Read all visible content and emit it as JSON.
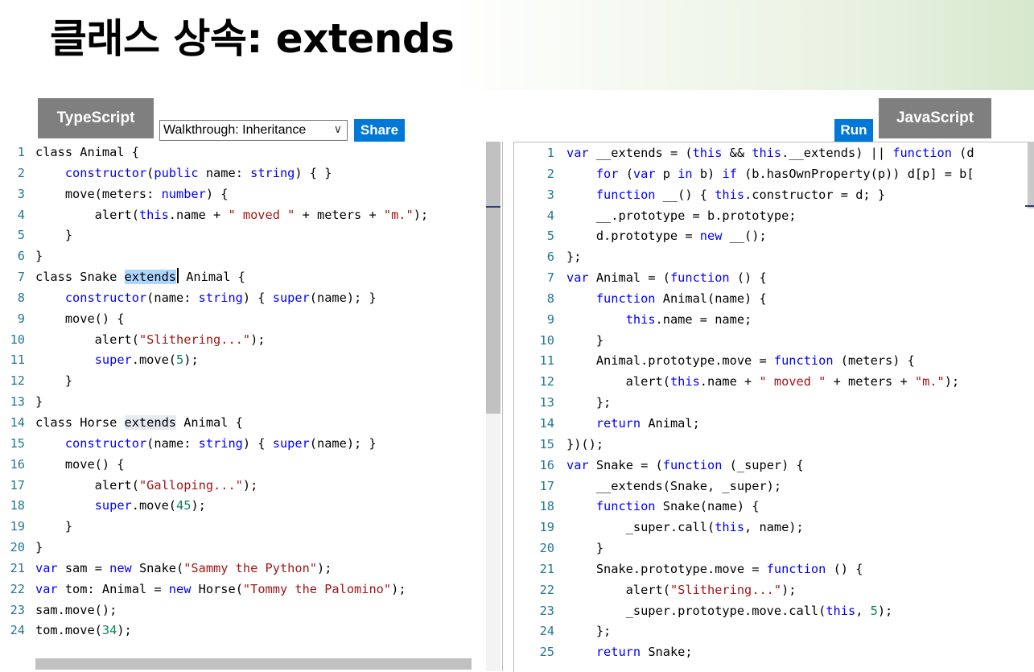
{
  "page_title": "클래스 상속: extends",
  "typescript_tab": "TypeScript",
  "javascript_tab": "JavaScript",
  "walkthrough_select": {
    "selected": "Walkthrough: Inheritance"
  },
  "share_button": "Share",
  "run_button": "Run",
  "ts_code": [
    {
      "n": "1",
      "t": [
        [
          "p",
          "class Animal {"
        ]
      ]
    },
    {
      "n": "2",
      "t": [
        [
          "p",
          "    "
        ],
        [
          "k",
          "constructor"
        ],
        [
          "p",
          "("
        ],
        [
          "k",
          "public"
        ],
        [
          "p",
          " name: "
        ],
        [
          "k",
          "string"
        ],
        [
          "p",
          ") { }"
        ]
      ]
    },
    {
      "n": "3",
      "t": [
        [
          "p",
          "    move(meters: "
        ],
        [
          "k",
          "number"
        ],
        [
          "p",
          ") {"
        ]
      ]
    },
    {
      "n": "4",
      "t": [
        [
          "p",
          "        alert("
        ],
        [
          "k",
          "this"
        ],
        [
          "p",
          ".name + "
        ],
        [
          "s",
          "\" moved \""
        ],
        [
          "p",
          " + meters + "
        ],
        [
          "s",
          "\"m.\""
        ],
        [
          "p",
          ");"
        ]
      ]
    },
    {
      "n": "5",
      "t": [
        [
          "p",
          "    }"
        ]
      ]
    },
    {
      "n": "6",
      "t": [
        [
          "p",
          "}"
        ]
      ]
    },
    {
      "n": "7",
      "t": [
        [
          "p",
          "class Snake "
        ],
        [
          "h",
          "extends"
        ],
        [
          "c",
          ""
        ],
        [
          "p",
          " Animal {"
        ]
      ]
    },
    {
      "n": "8",
      "t": [
        [
          "p",
          "    "
        ],
        [
          "k",
          "constructor"
        ],
        [
          "p",
          "(name: "
        ],
        [
          "k",
          "string"
        ],
        [
          "p",
          ") { "
        ],
        [
          "k",
          "super"
        ],
        [
          "p",
          "(name); }"
        ]
      ]
    },
    {
      "n": "9",
      "t": [
        [
          "p",
          "    move() {"
        ]
      ]
    },
    {
      "n": "10",
      "t": [
        [
          "p",
          "        alert("
        ],
        [
          "s",
          "\"Slithering...\""
        ],
        [
          "p",
          ");"
        ]
      ]
    },
    {
      "n": "11",
      "t": [
        [
          "p",
          "        "
        ],
        [
          "k",
          "super"
        ],
        [
          "p",
          ".move("
        ],
        [
          "n",
          "5"
        ],
        [
          "p",
          ");"
        ]
      ]
    },
    {
      "n": "12",
      "t": [
        [
          "p",
          "    }"
        ]
      ]
    },
    {
      "n": "13",
      "t": [
        [
          "p",
          "}"
        ]
      ]
    },
    {
      "n": "14",
      "t": [
        [
          "p",
          "class Horse "
        ],
        [
          "h2",
          "extends"
        ],
        [
          "p",
          " Animal {"
        ]
      ]
    },
    {
      "n": "15",
      "t": [
        [
          "p",
          "    "
        ],
        [
          "k",
          "constructor"
        ],
        [
          "p",
          "(name: "
        ],
        [
          "k",
          "string"
        ],
        [
          "p",
          ") { "
        ],
        [
          "k",
          "super"
        ],
        [
          "p",
          "(name); }"
        ]
      ]
    },
    {
      "n": "16",
      "t": [
        [
          "p",
          "    move() {"
        ]
      ]
    },
    {
      "n": "17",
      "t": [
        [
          "p",
          "        alert("
        ],
        [
          "s",
          "\"Galloping...\""
        ],
        [
          "p",
          ");"
        ]
      ]
    },
    {
      "n": "18",
      "t": [
        [
          "p",
          "        "
        ],
        [
          "k",
          "super"
        ],
        [
          "p",
          ".move("
        ],
        [
          "n",
          "45"
        ],
        [
          "p",
          ");"
        ]
      ]
    },
    {
      "n": "19",
      "t": [
        [
          "p",
          "    }"
        ]
      ]
    },
    {
      "n": "20",
      "t": [
        [
          "p",
          "}"
        ]
      ]
    },
    {
      "n": "21",
      "t": [
        [
          "k",
          "var"
        ],
        [
          "p",
          " sam = "
        ],
        [
          "k",
          "new"
        ],
        [
          "p",
          " Snake("
        ],
        [
          "s",
          "\"Sammy the Python\""
        ],
        [
          "p",
          ");"
        ]
      ]
    },
    {
      "n": "22",
      "t": [
        [
          "k",
          "var"
        ],
        [
          "p",
          " tom: Animal = "
        ],
        [
          "k",
          "new"
        ],
        [
          "p",
          " Horse("
        ],
        [
          "s",
          "\"Tommy the Palomino\""
        ],
        [
          "p",
          ");"
        ]
      ]
    },
    {
      "n": "23",
      "t": [
        [
          "p",
          "sam.move();"
        ]
      ]
    },
    {
      "n": "24",
      "t": [
        [
          "p",
          "tom.move("
        ],
        [
          "n",
          "34"
        ],
        [
          "p",
          ");"
        ]
      ]
    }
  ],
  "js_code": [
    {
      "n": "1",
      "t": [
        [
          "k",
          "var"
        ],
        [
          "p",
          " __extends = ("
        ],
        [
          "k",
          "this"
        ],
        [
          "p",
          " && "
        ],
        [
          "k",
          "this"
        ],
        [
          "p",
          ".__extends) || "
        ],
        [
          "k",
          "function"
        ],
        [
          "p",
          " (d"
        ]
      ]
    },
    {
      "n": "2",
      "t": [
        [
          "p",
          "    "
        ],
        [
          "k",
          "for"
        ],
        [
          "p",
          " ("
        ],
        [
          "k",
          "var"
        ],
        [
          "p",
          " p "
        ],
        [
          "k",
          "in"
        ],
        [
          "p",
          " b) "
        ],
        [
          "k",
          "if"
        ],
        [
          "p",
          " (b.hasOwnProperty(p)) d[p] = b["
        ]
      ]
    },
    {
      "n": "3",
      "t": [
        [
          "p",
          "    "
        ],
        [
          "k",
          "function"
        ],
        [
          "p",
          " __() { "
        ],
        [
          "k",
          "this"
        ],
        [
          "p",
          ".constructor = d; }"
        ]
      ]
    },
    {
      "n": "4",
      "t": [
        [
          "p",
          "    __.prototype = b.prototype;"
        ]
      ]
    },
    {
      "n": "5",
      "t": [
        [
          "p",
          "    d.prototype = "
        ],
        [
          "k",
          "new"
        ],
        [
          "p",
          " __();"
        ]
      ]
    },
    {
      "n": "6",
      "t": [
        [
          "p",
          "};"
        ]
      ]
    },
    {
      "n": "7",
      "t": [
        [
          "k",
          "var"
        ],
        [
          "p",
          " Animal = ("
        ],
        [
          "k",
          "function"
        ],
        [
          "p",
          " () {"
        ]
      ]
    },
    {
      "n": "8",
      "t": [
        [
          "p",
          "    "
        ],
        [
          "k",
          "function"
        ],
        [
          "p",
          " Animal(name) {"
        ]
      ]
    },
    {
      "n": "9",
      "t": [
        [
          "p",
          "        "
        ],
        [
          "k",
          "this"
        ],
        [
          "p",
          ".name = name;"
        ]
      ]
    },
    {
      "n": "10",
      "t": [
        [
          "p",
          "    }"
        ]
      ]
    },
    {
      "n": "11",
      "t": [
        [
          "p",
          "    Animal.prototype.move = "
        ],
        [
          "k",
          "function"
        ],
        [
          "p",
          " (meters) {"
        ]
      ]
    },
    {
      "n": "12",
      "t": [
        [
          "p",
          "        alert("
        ],
        [
          "k",
          "this"
        ],
        [
          "p",
          ".name + "
        ],
        [
          "s",
          "\" moved \""
        ],
        [
          "p",
          " + meters + "
        ],
        [
          "s",
          "\"m.\""
        ],
        [
          "p",
          ");"
        ]
      ]
    },
    {
      "n": "13",
      "t": [
        [
          "p",
          "    };"
        ]
      ]
    },
    {
      "n": "14",
      "t": [
        [
          "p",
          "    "
        ],
        [
          "k",
          "return"
        ],
        [
          "p",
          " Animal;"
        ]
      ]
    },
    {
      "n": "15",
      "t": [
        [
          "p",
          "})();"
        ]
      ]
    },
    {
      "n": "16",
      "t": [
        [
          "k",
          "var"
        ],
        [
          "p",
          " Snake = ("
        ],
        [
          "k",
          "function"
        ],
        [
          "p",
          " (_super) {"
        ]
      ]
    },
    {
      "n": "17",
      "t": [
        [
          "p",
          "    __extends(Snake, _super);"
        ]
      ]
    },
    {
      "n": "18",
      "t": [
        [
          "p",
          "    "
        ],
        [
          "k",
          "function"
        ],
        [
          "p",
          " Snake(name) {"
        ]
      ]
    },
    {
      "n": "19",
      "t": [
        [
          "p",
          "        _super.call("
        ],
        [
          "k",
          "this"
        ],
        [
          "p",
          ", name);"
        ]
      ]
    },
    {
      "n": "20",
      "t": [
        [
          "p",
          "    }"
        ]
      ]
    },
    {
      "n": "21",
      "t": [
        [
          "p",
          "    Snake.prototype.move = "
        ],
        [
          "k",
          "function"
        ],
        [
          "p",
          " () {"
        ]
      ]
    },
    {
      "n": "22",
      "t": [
        [
          "p",
          "        alert("
        ],
        [
          "s",
          "\"Slithering...\""
        ],
        [
          "p",
          ");"
        ]
      ]
    },
    {
      "n": "23",
      "t": [
        [
          "p",
          "        _super.prototype.move.call("
        ],
        [
          "k",
          "this"
        ],
        [
          "p",
          ", "
        ],
        [
          "n",
          "5"
        ],
        [
          "p",
          ");"
        ]
      ]
    },
    {
      "n": "24",
      "t": [
        [
          "p",
          "    };"
        ]
      ]
    },
    {
      "n": "25",
      "t": [
        [
          "p",
          "    "
        ],
        [
          "k",
          "return"
        ],
        [
          "p",
          " Snake;"
        ]
      ]
    }
  ]
}
